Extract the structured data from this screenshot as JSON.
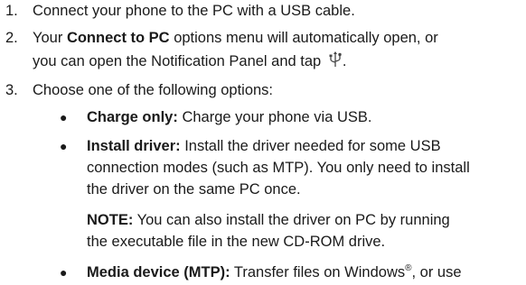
{
  "steps": [
    {
      "number": "1.",
      "text": "Connect your phone to the PC with a USB cable."
    },
    {
      "number": "2.",
      "text_a": "Your ",
      "bold": "Connect to PC",
      "text_b": " options menu will automatically open, or",
      "text_c": "you can open the Notification Panel and tap ",
      "icon": "usb-icon",
      "text_d": "."
    },
    {
      "number": "3.",
      "text": "Choose one of the following options:",
      "options": [
        {
          "title": "Charge only:",
          "lines": [
            " Charge your phone via USB."
          ]
        },
        {
          "title": "Install driver:",
          "lines": [
            " Install the driver needed for some USB",
            "connection modes (such as MTP). You only need to install",
            "the driver on the same PC once."
          ],
          "note_label": "NOTE:",
          "note_lines": [
            " You can also install the driver on PC by running",
            "the executable file in the new CD-ROM drive."
          ]
        },
        {
          "title": "Media device (MTP):",
          "text_a": " Transfer files on Windows",
          "reg": "®",
          "text_b": ", or use"
        }
      ]
    }
  ]
}
